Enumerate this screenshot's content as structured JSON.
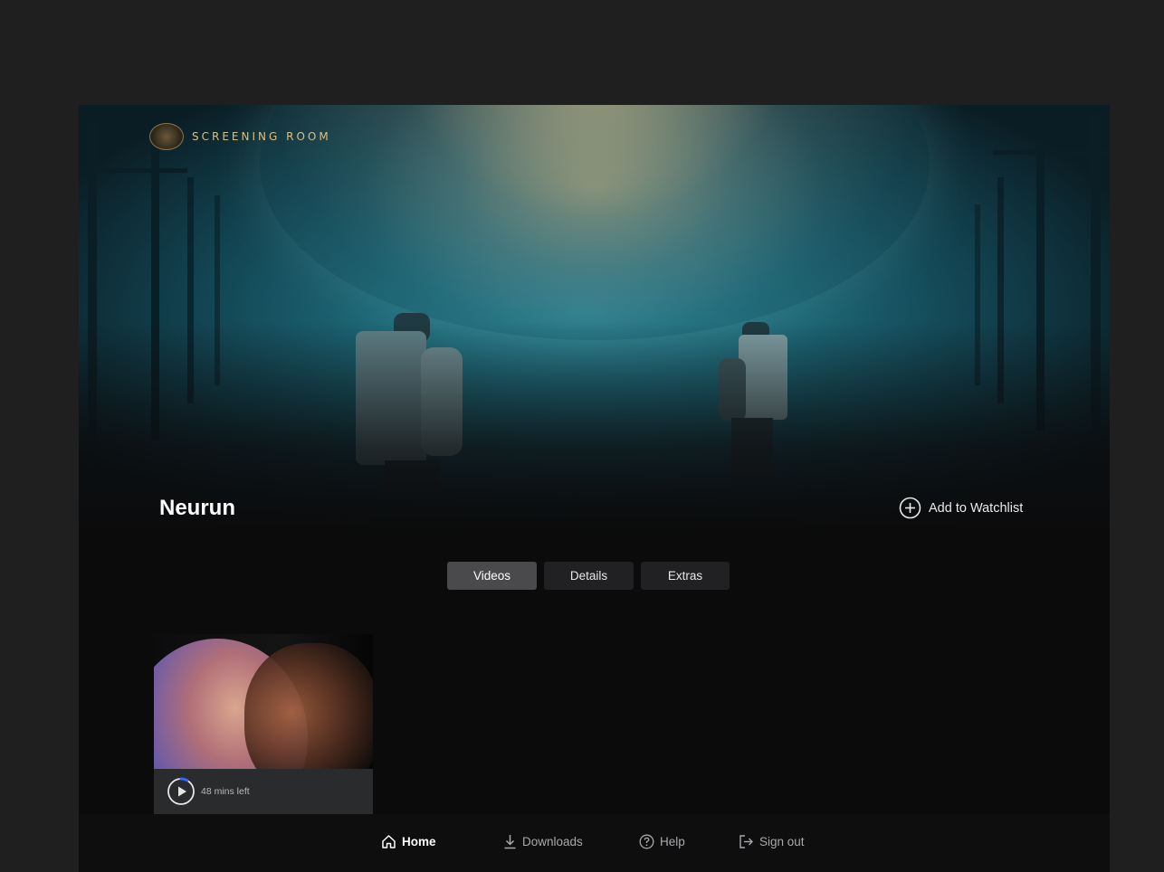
{
  "brand": {
    "name": "SCREENING ROOM",
    "logo_icon": "studio-crest-icon"
  },
  "title": {
    "text": "Neurun"
  },
  "watchlist": {
    "label": "Add to Watchlist",
    "icon": "plus-circle-icon"
  },
  "tabs": [
    {
      "label": "Videos",
      "active": true
    },
    {
      "label": "Details",
      "active": false
    },
    {
      "label": "Extras",
      "active": false
    }
  ],
  "videos": [
    {
      "remaining": "48 mins left",
      "progress_percent": 8,
      "icon": "play-icon"
    }
  ],
  "nav": [
    {
      "label": "Home",
      "icon": "home-icon",
      "active": true
    },
    {
      "label": "Downloads",
      "icon": "download-icon",
      "active": false
    },
    {
      "label": "Help",
      "icon": "help-circle-icon",
      "active": false
    },
    {
      "label": "Sign out",
      "icon": "sign-out-icon",
      "active": false
    }
  ],
  "colors": {
    "accent": "#2f6bff",
    "brand_gold": "#d8bf86",
    "background": "#0b0b0c"
  }
}
